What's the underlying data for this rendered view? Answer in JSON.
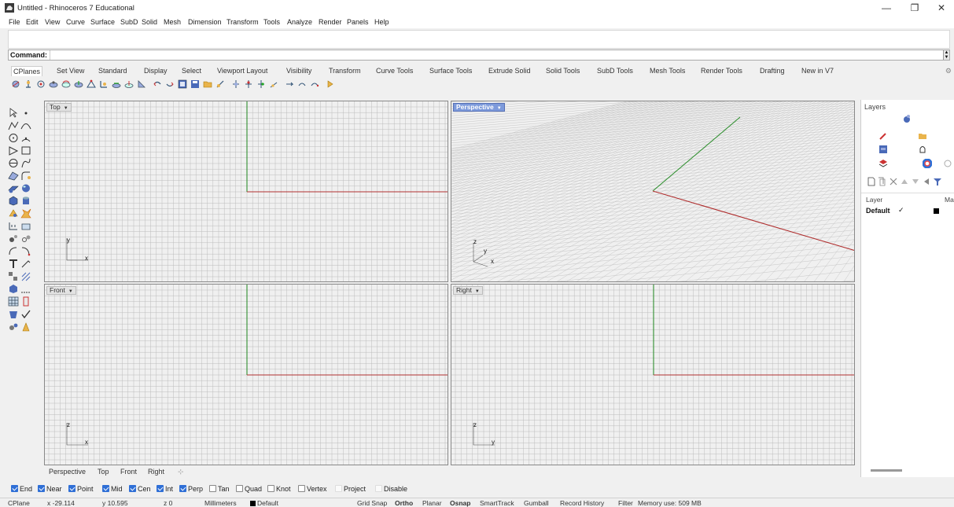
{
  "window": {
    "title": "Untitled - Rhinoceros 7 Educational",
    "min_glyph": "—",
    "max_glyph": "❐",
    "close_glyph": "✕"
  },
  "menu": [
    "File",
    "Edit",
    "View",
    "Curve",
    "Surface",
    "SubD",
    "Solid",
    "Mesh",
    "Dimension",
    "Transform",
    "Tools",
    "Analyze",
    "Render",
    "Panels",
    "Help"
  ],
  "command": {
    "label": "Command:",
    "value": ""
  },
  "toolbar_tabs": [
    "CPlanes",
    "Set View",
    "Standard",
    "Display",
    "Select",
    "Viewport Layout",
    "Visibility",
    "Transform",
    "Curve Tools",
    "Surface Tools",
    "Extrude Solid",
    "Solid Tools",
    "SubD Tools",
    "Mesh Tools",
    "Render Tools",
    "Drafting",
    "New in V7"
  ],
  "active_toolbar_tab": "CPlanes",
  "viewports": {
    "top": {
      "label": "Top",
      "axis_h": "x",
      "axis_v": "y"
    },
    "perspective": {
      "label": "Perspective",
      "axis_h": "x",
      "axis_v": "y",
      "axis_z": "z"
    },
    "front": {
      "label": "Front",
      "axis_h": "x",
      "axis_v": "z"
    },
    "right": {
      "label": "Right",
      "axis_h": "y",
      "axis_v": "z"
    }
  },
  "viewport_tabs": [
    "Perspective",
    "Top",
    "Front",
    "Right"
  ],
  "viewport_tab_add": "⊹",
  "layers_panel": {
    "title": "Layers",
    "col_layer": "Layer",
    "col_material": "Ma",
    "rows": [
      {
        "name": "Default",
        "current_mark": "✓"
      }
    ]
  },
  "osnaps": [
    {
      "label": "End",
      "checked": true
    },
    {
      "label": "Near",
      "checked": true
    },
    {
      "label": "Point",
      "checked": true
    },
    {
      "label": "Mid",
      "checked": true
    },
    {
      "label": "Cen",
      "checked": true
    },
    {
      "label": "Int",
      "checked": true
    },
    {
      "label": "Perp",
      "checked": true
    },
    {
      "label": "Tan",
      "checked": false
    },
    {
      "label": "Quad",
      "checked": false
    },
    {
      "label": "Knot",
      "checked": false
    },
    {
      "label": "Vertex",
      "checked": false
    },
    {
      "label": "Project",
      "checked": false
    },
    {
      "label": "Disable",
      "checked": false
    }
  ],
  "status": {
    "cplane": "CPlane",
    "x": "x -29.114",
    "y": "y 10.595",
    "z": "z 0",
    "units": "Millimeters",
    "layer": "Default",
    "grid_snap": "Grid Snap",
    "ortho": "Ortho",
    "planar": "Planar",
    "osnap": "Osnap",
    "smarttrack": "SmartTrack",
    "gumball": "Gumball",
    "record_history": "Record History",
    "filter": "Filter",
    "memory": "Memory use: 509 MB"
  },
  "colors": {
    "x_axis": "#b03030",
    "y_axis": "#2f8f2f",
    "grid_line": "#bcbcbc",
    "viewport_bg": "#ffffff",
    "active_label": "#7d9adb",
    "checkbox_on": "#2f6fd6"
  }
}
